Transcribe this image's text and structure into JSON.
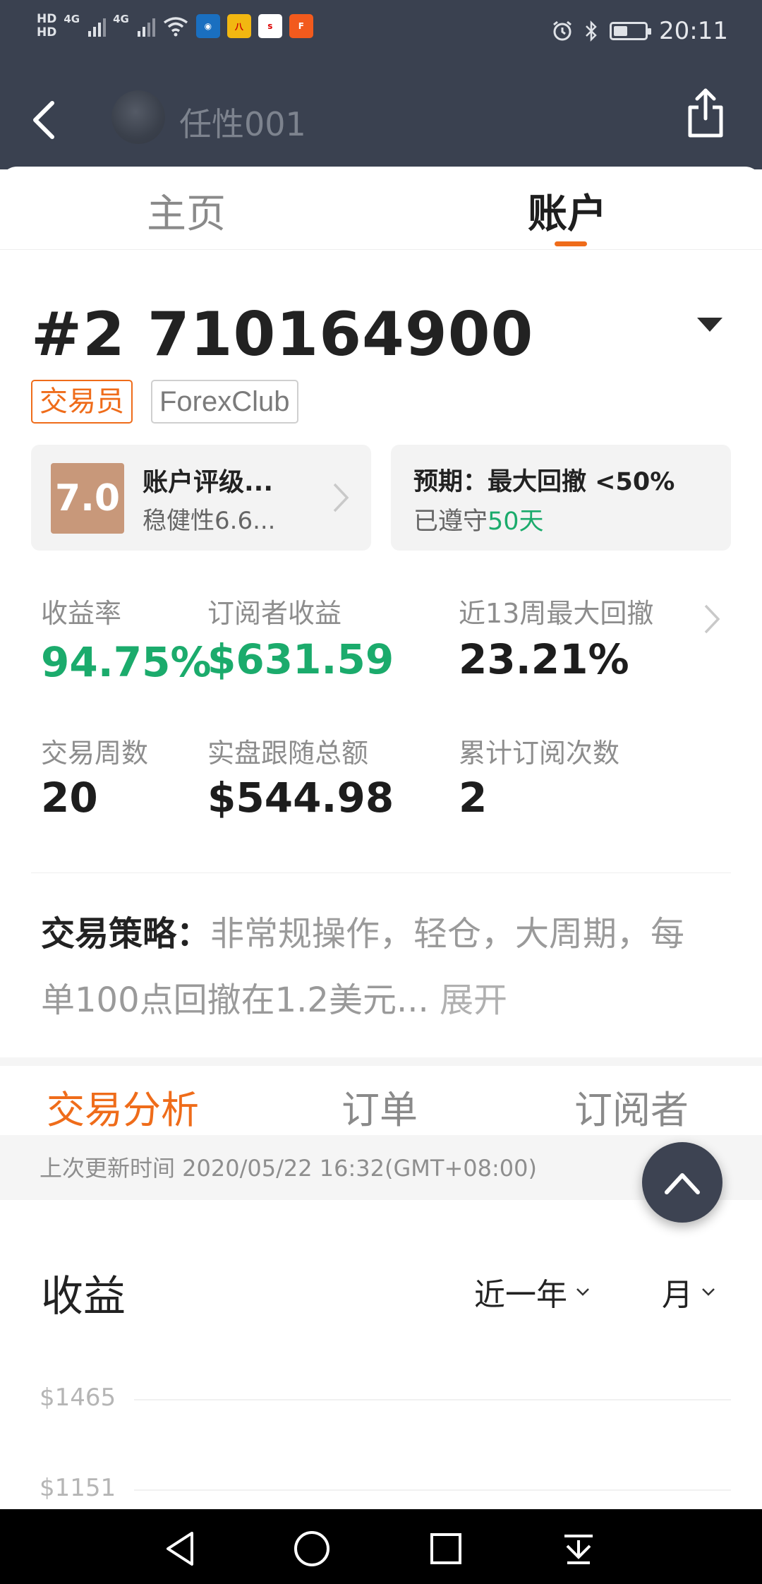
{
  "status_bar": {
    "time": "20:11",
    "hd1": "HD",
    "hd2": "HD",
    "net1": "4G",
    "net2": "4G",
    "battery_level": 0.45,
    "app_icons": [
      "globe-app-icon",
      "news-app-icon",
      "sina-app-icon",
      "f-app-icon"
    ]
  },
  "header": {
    "nickname": "任性001"
  },
  "tabs": {
    "home": "主页",
    "account": "账户"
  },
  "account": {
    "number": "#2 710164900",
    "badge_trader": "交易员",
    "badge_broker": "ForexClub"
  },
  "rating_card": {
    "score": "7.0",
    "title": "账户评级...",
    "subtitle": "稳健性6.6..."
  },
  "expect_card": {
    "title": "预期：最大回撤 <50%",
    "kept_prefix": "已遵守",
    "kept_days": "50天"
  },
  "stats": {
    "return_label": "收益率",
    "return_value": "94.75%",
    "sub_profit_label": "订阅者收益",
    "sub_profit_value": "$631.59",
    "drawdown_label": "近13周最大回撤",
    "drawdown_value": "23.21%",
    "weeks_label": "交易周数",
    "weeks_value": "20",
    "follow_label": "实盘跟随总额",
    "follow_value": "$544.98",
    "subs_label": "累计订阅次数",
    "subs_value": "2"
  },
  "strategy": {
    "label": "交易策略：",
    "text": "非常规操作，轻仓，大周期，每单100点回撤在1.2美元...",
    "expand": "展开"
  },
  "sub_tabs": {
    "analysis": "交易分析",
    "orders": "订单",
    "subscribers": "订阅者"
  },
  "update": {
    "text": "上次更新时间 2020/05/22 16:32(GMT+08:00)"
  },
  "chart_section": {
    "title": "收益",
    "range_filter": "近一年",
    "period_filter": "月"
  },
  "chart_data": {
    "type": "bar",
    "title": "收益",
    "y_ticks": [
      "$1465",
      "$1151"
    ],
    "grid": true
  },
  "colors": {
    "accent": "#ef6c1a",
    "positive": "#1bab6c",
    "header_bg": "#3a4150",
    "rating_bg": "#c8987a"
  }
}
